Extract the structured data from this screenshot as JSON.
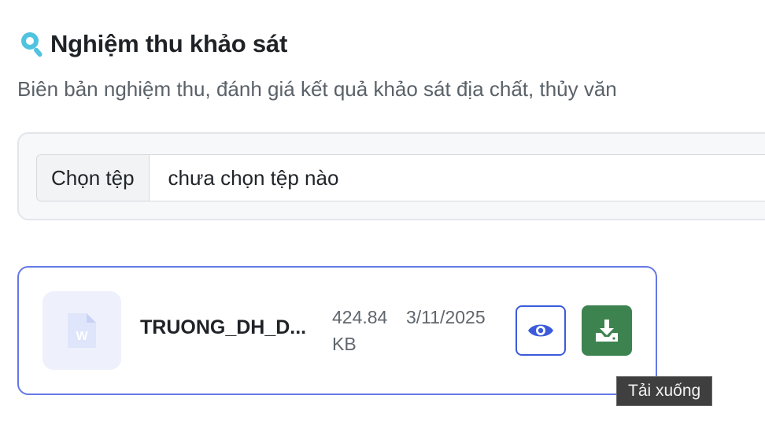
{
  "section": {
    "icon": "search-location-icon",
    "title": "Nghiệm thu khảo sát",
    "description": "Biên bản nghiệm thu, đánh giá kết quả khảo sát địa chất, thủy văn"
  },
  "upload": {
    "choose_label": "Chọn tệp",
    "status": "chưa chọn tệp nào"
  },
  "file": {
    "icon": "word-document-icon",
    "name": "TRUONG_DH_D...",
    "size": "424.84 KB",
    "date": "3/11/2025",
    "view_icon": "eye-icon",
    "download_icon": "download-icon"
  },
  "tooltip": {
    "text": "Tải xuống"
  },
  "colors": {
    "accent_blue": "#3b5bdb",
    "card_border": "#6678e6",
    "download_green": "#3d8350",
    "icon_cyan": "#4fc3e0"
  }
}
